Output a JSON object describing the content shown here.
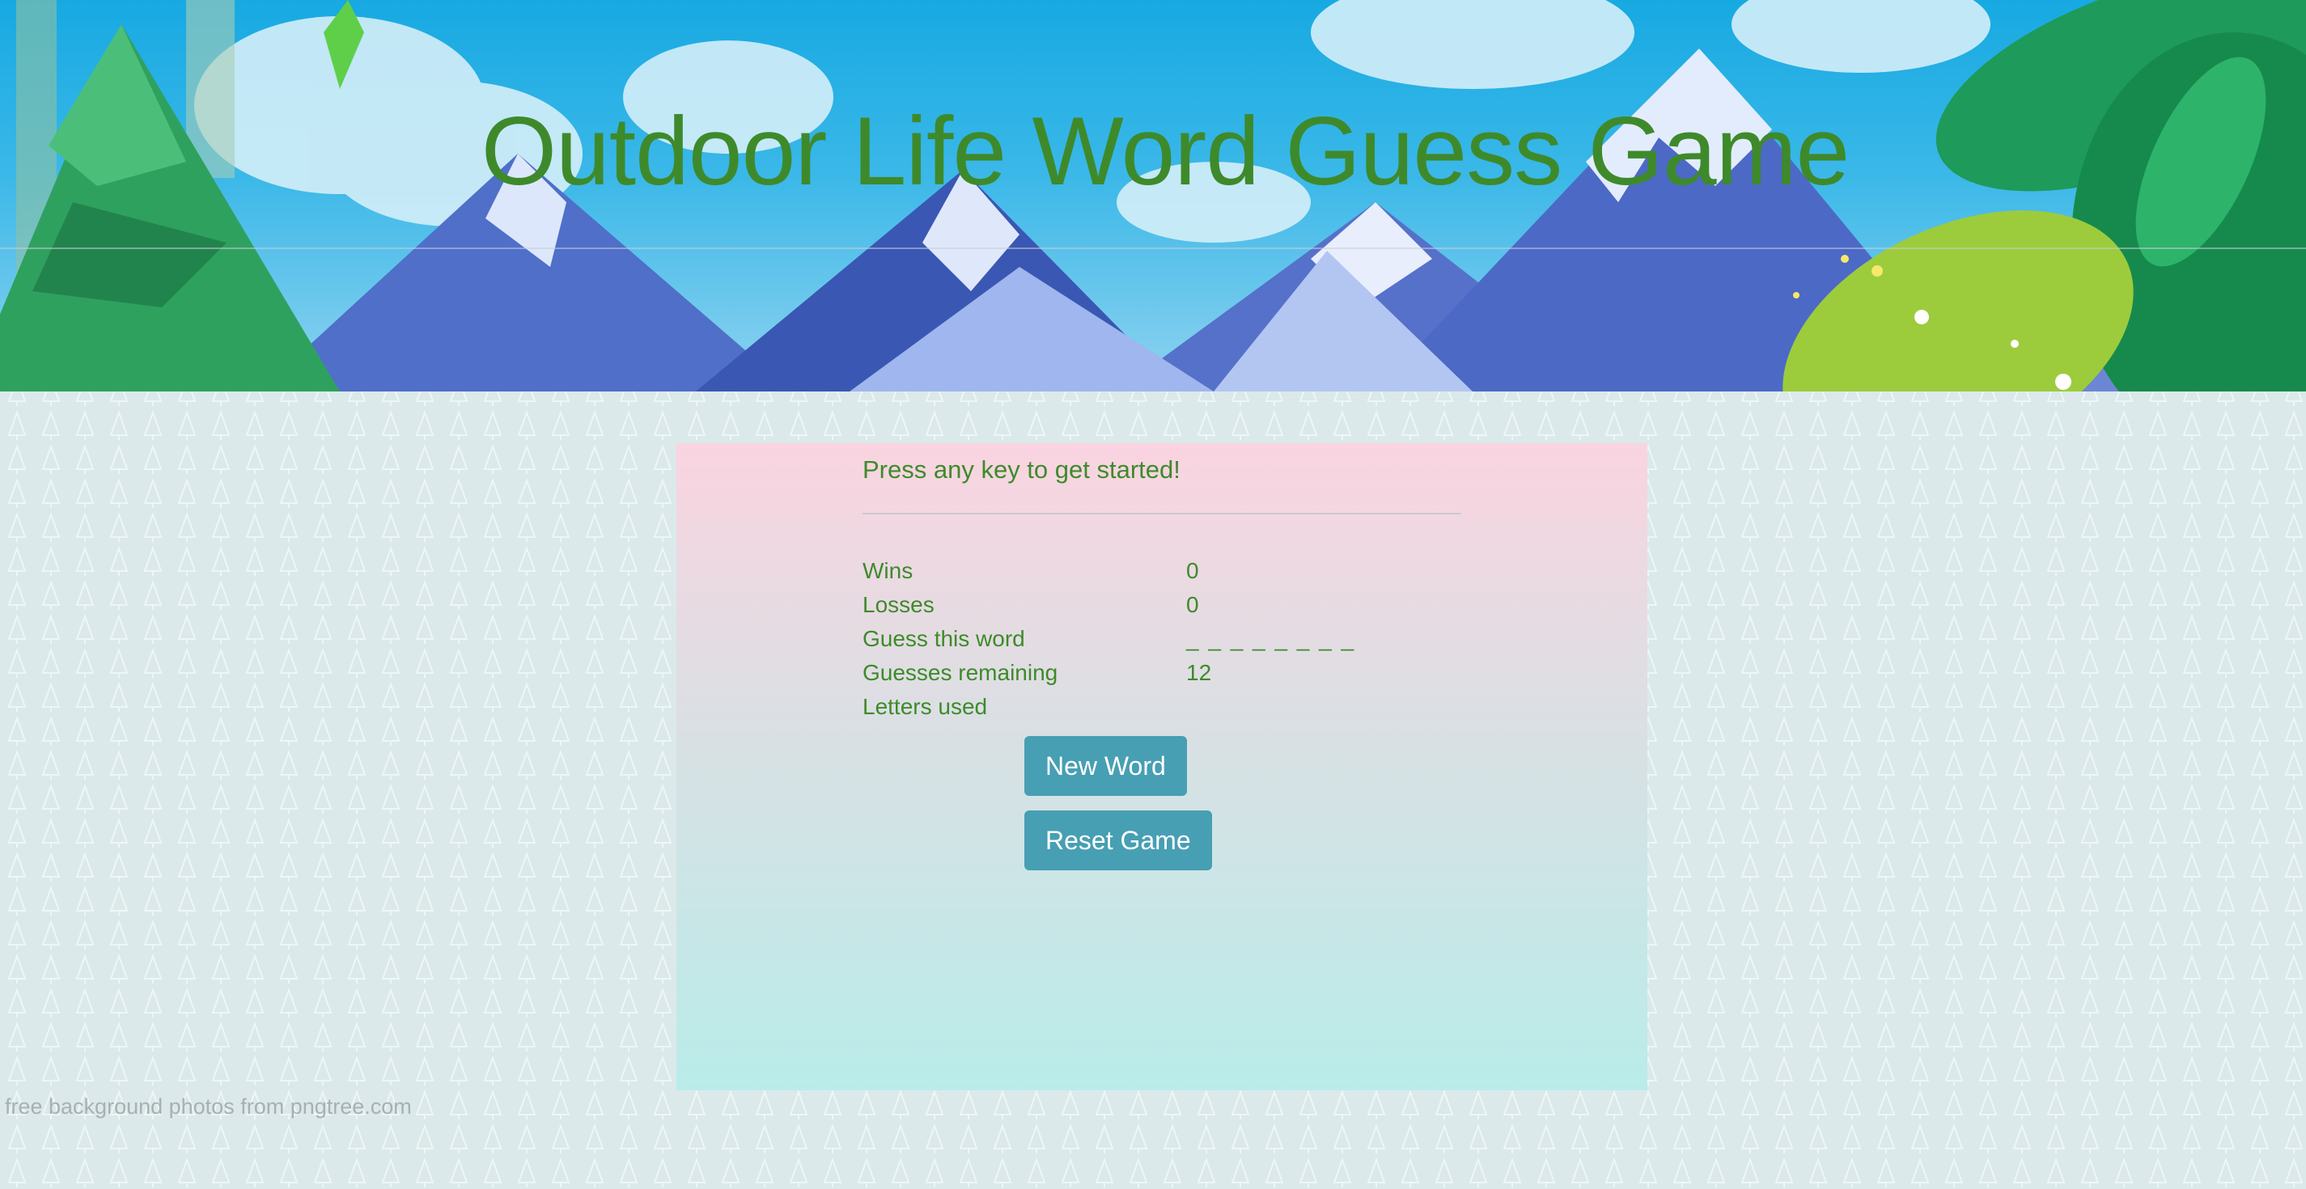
{
  "header": {
    "title": "Outdoor Life Word Guess Game"
  },
  "game": {
    "prompt": "Press any key to get started!",
    "stats": [
      {
        "label": "Wins",
        "value": "0"
      },
      {
        "label": "Losses",
        "value": "0"
      },
      {
        "label": "Guess this word",
        "value": "_ _ _ _ _ _ _ _"
      },
      {
        "label": "Guesses remaining",
        "value": "12"
      },
      {
        "label": "Letters used",
        "value": ""
      }
    ],
    "buttons": {
      "new_word": "New Word",
      "reset_game": "Reset Game"
    }
  },
  "footer": {
    "credit": "free background photos from pngtree.com"
  },
  "colors": {
    "text_green": "#3e8a2b",
    "button_teal": "#479fb3",
    "panel_top": "#fad4e0",
    "panel_bottom": "#b9ece9",
    "page_bg": "#dbe9ea"
  }
}
